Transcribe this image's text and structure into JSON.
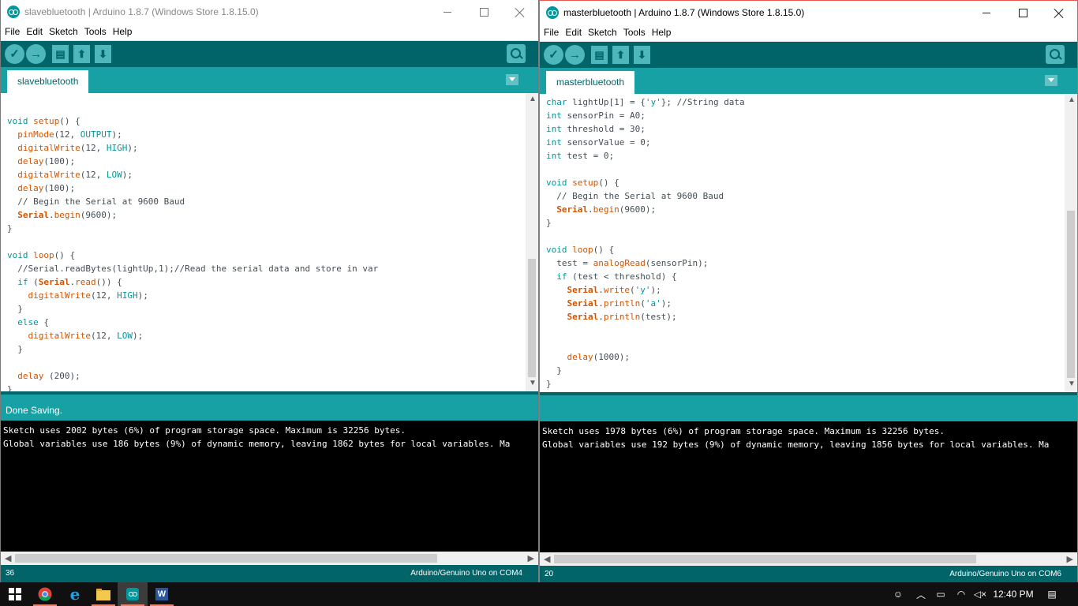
{
  "windows": {
    "left": {
      "title": "slavebluetooth | Arduino 1.8.7 (Windows Store 1.8.15.0)",
      "menu": [
        "File",
        "Edit",
        "Sketch",
        "Tools",
        "Help"
      ],
      "tab": "slavebluetooth",
      "code": [
        "",
        "void setup() {",
        "  pinMode(12, OUTPUT);",
        "  digitalWrite(12, HIGH);",
        "  delay(100);",
        "  digitalWrite(12, LOW);",
        "  delay(100);",
        "  // Begin the Serial at 9600 Baud",
        "  Serial.begin(9600);",
        "}",
        "",
        "void loop() {",
        "  //Serial.readBytes(lightUp,1);//Read the serial data and store in var",
        "  if (Serial.read()) {",
        "    digitalWrite(12, HIGH);",
        "  }",
        "  else {",
        "    digitalWrite(12, LOW);",
        "  }",
        "",
        "  delay (200);",
        "}"
      ],
      "status": "Done Saving.",
      "console": [
        "Sketch uses 2002 bytes (6%) of program storage space. Maximum is 32256 bytes.",
        "Global variables use 186 bytes (9%) of dynamic memory, leaving 1862 bytes for local variables. Ma"
      ],
      "line_number": "36",
      "board": "Arduino/Genuino Uno on COM4"
    },
    "right": {
      "title": "masterbluetooth | Arduino 1.8.7 (Windows Store 1.8.15.0)",
      "menu": [
        "File",
        "Edit",
        "Sketch",
        "Tools",
        "Help"
      ],
      "tab": "masterbluetooth",
      "code": [
        "char lightUp[1] = {'y'}; //String data",
        "int sensorPin = A0;",
        "int threshold = 30;",
        "int sensorValue = 0;",
        "int test = 0;",
        "",
        "void setup() {",
        "  // Begin the Serial at 9600 Baud",
        "  Serial.begin(9600);",
        "}",
        "",
        "void loop() {",
        "  test = analogRead(sensorPin);",
        "  if (test < threshold) {",
        "    Serial.write('y');",
        "    Serial.println('a');",
        "    Serial.println(test);",
        "",
        "",
        "    delay(1000);",
        "  }",
        "}"
      ],
      "status": "",
      "console": [
        "Sketch uses 1978 bytes (6%) of program storage space. Maximum is 32256 bytes.",
        "Global variables use 192 bytes (9%) of dynamic memory, leaving 1856 bytes for local variables. Ma"
      ],
      "line_number": "20",
      "board": "Arduino/Genuino Uno on COM6"
    }
  },
  "taskbar": {
    "clock": "12:40 PM",
    "apps": [
      "chrome-icon",
      "internet-explorer-icon",
      "file-explorer-icon",
      "arduino-icon",
      "word-icon"
    ]
  },
  "colors": {
    "toolbar": "#006468",
    "tabbar": "#17a1a5",
    "console": "#000000",
    "taskbar": "#101010"
  }
}
